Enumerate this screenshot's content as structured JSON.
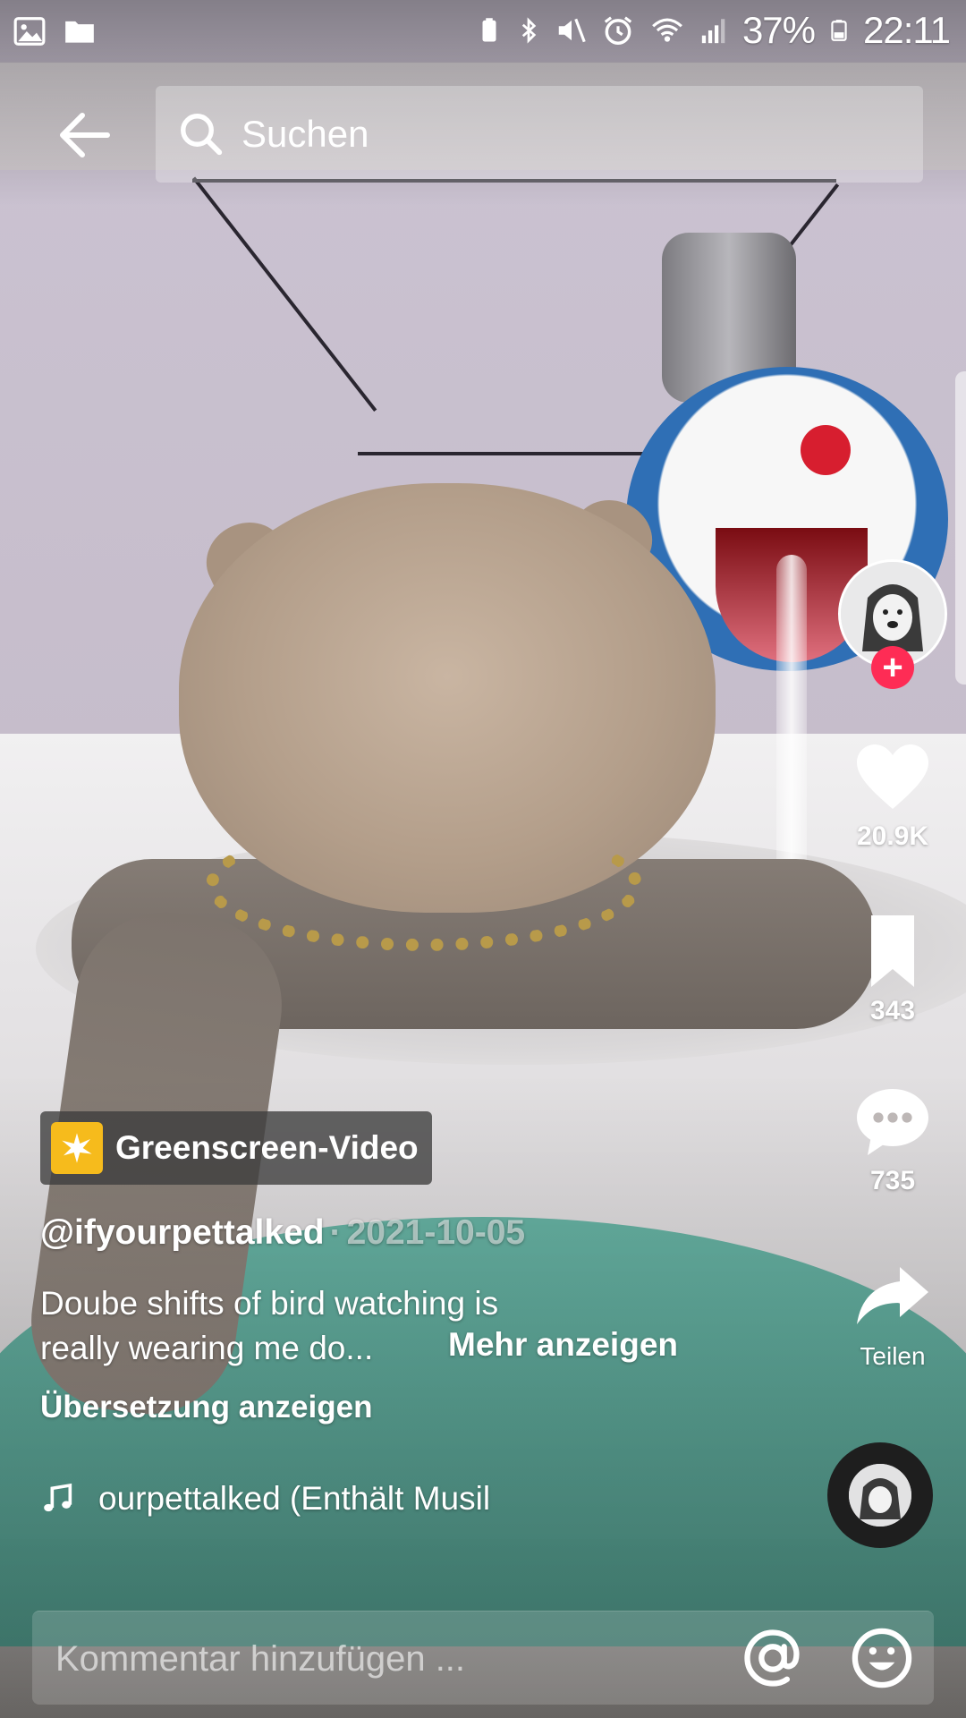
{
  "status_bar": {
    "left_icons": [
      "gallery-icon",
      "folder-icon"
    ],
    "right_icons": [
      "battery-saver-icon",
      "bluetooth-icon",
      "mute-icon",
      "alarm-icon",
      "wifi-icon",
      "signal-icon",
      "battery-icon"
    ],
    "battery": "37%",
    "time": "22:11"
  },
  "top_bar": {
    "back_icon": "arrow-left-icon",
    "search_placeholder": "Suchen"
  },
  "actions": {
    "likes": "20.9K",
    "saves": "343",
    "comments": "735",
    "share_label": "Teilen"
  },
  "caption": {
    "badge_label": "Greenscreen-Video",
    "author": "@ifyourpettalked",
    "separator": "·",
    "date": "2021-10-05",
    "text": "Doube shifts of bird watching is really wearing me do...",
    "more_label": "Mehr anzeigen",
    "translate_label": "Übersetzung anzeigen",
    "music_text": "ourpettalked (Enthält Musil"
  },
  "comment_bar": {
    "placeholder": "Kommentar hinzufügen ..."
  },
  "colors": {
    "accent": "#fe2c55",
    "badge_yellow": "#f6bb1c"
  }
}
